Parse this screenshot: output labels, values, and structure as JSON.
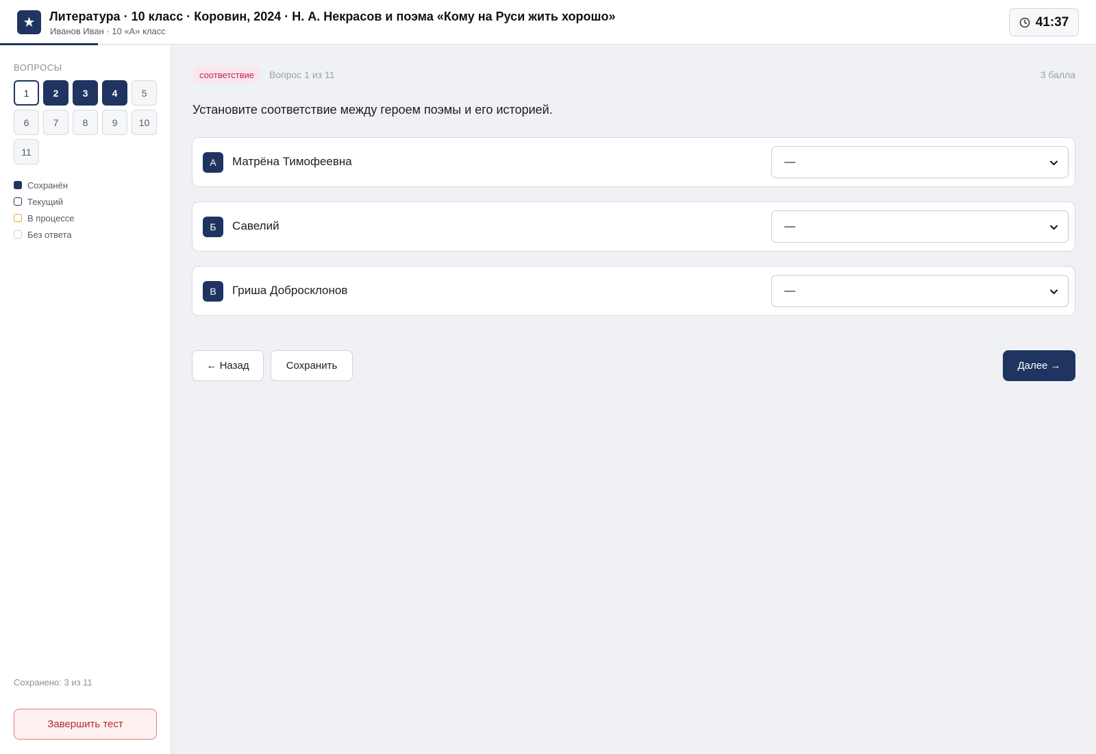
{
  "header": {
    "logo_glyph": "★",
    "title": "Литература · 10 класс · Коровин, 2024 · Н. А. Некрасов и поэма «Кому на Руси жить хорошо»",
    "subtitle": "Иванов Иван · 10 «А» класс",
    "timer": "41:37",
    "timer_icon": "clock-icon"
  },
  "sidebar": {
    "heading": "Вопросы",
    "questions": [
      {
        "number": "1",
        "state": "current"
      },
      {
        "number": "2",
        "state": "saved"
      },
      {
        "number": "3",
        "state": "saved"
      },
      {
        "number": "4",
        "state": "saved"
      },
      {
        "number": "5",
        "state": "unanswered"
      },
      {
        "number": "6",
        "state": "unanswered"
      },
      {
        "number": "7",
        "state": "unanswered"
      },
      {
        "number": "8",
        "state": "unanswered"
      },
      {
        "number": "9",
        "state": "unanswered"
      },
      {
        "number": "10",
        "state": "unanswered"
      },
      {
        "number": "11",
        "state": "unanswered"
      }
    ],
    "legend": [
      {
        "label": "Сохранён",
        "state": "saved"
      },
      {
        "label": "Текущий",
        "state": "current"
      },
      {
        "label": "В процессе",
        "state": "progress"
      },
      {
        "label": "Без ответа",
        "state": "none"
      }
    ],
    "saved_count": "Сохранено: 3 из 11",
    "finish_label": "Завершить тест"
  },
  "question": {
    "type_badge": "соответствие",
    "counter": "Вопрос 1 из 11",
    "points": "3 балла",
    "text": "Установите соответствие между героем поэмы и его историей.",
    "rows": [
      {
        "letter": "А",
        "label": "Матрёна Тимофеевна",
        "selected": "—"
      },
      {
        "letter": "Б",
        "label": "Савелий",
        "selected": "—"
      },
      {
        "letter": "В",
        "label": "Гриша Добросклонов",
        "selected": "—"
      }
    ]
  },
  "nav": {
    "back_label": "← Назад",
    "save_label": "Сохранить",
    "next_label": "Далее →"
  },
  "colors": {
    "accent": "#1f3461",
    "badge_bg": "#fbe6ec",
    "badge_text": "#b8245a",
    "danger": "#b02a2a",
    "progress": "#e0a72a"
  }
}
